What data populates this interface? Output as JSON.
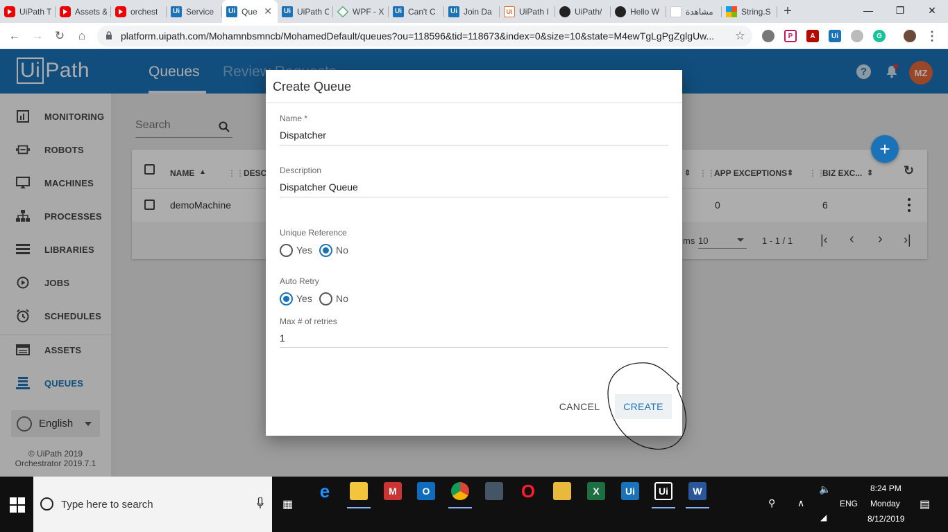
{
  "browser": {
    "tabs": [
      {
        "icon": "youtube-icon",
        "label": "UiPath T"
      },
      {
        "icon": "youtube-icon",
        "label": "Assets &"
      },
      {
        "icon": "youtube-icon",
        "label": "orchest"
      },
      {
        "icon": "uipath-icon",
        "label": "Service"
      },
      {
        "icon": "uipath-icon",
        "label": "Que",
        "active": true
      },
      {
        "icon": "uipath-icon",
        "label": "UiPath C"
      },
      {
        "icon": "wpf-icon",
        "label": "WPF - X"
      },
      {
        "icon": "uipath-icon",
        "label": "Can't C"
      },
      {
        "icon": "uipath-icon",
        "label": "Join Da"
      },
      {
        "icon": "uipath-orange-icon",
        "label": "UiPath I"
      },
      {
        "icon": "github-icon",
        "label": "UiPath/"
      },
      {
        "icon": "github-icon",
        "label": "Hello W"
      },
      {
        "icon": "arabic-site-icon",
        "label": "مشاهدة"
      },
      {
        "icon": "microsoft-icon",
        "label": "String.S"
      }
    ],
    "close_tab_glyph": "✕",
    "new_tab_glyph": "+",
    "url": "platform.uipath.com/Mohamnbsmncb/MohamedDefault/queues?ou=118596&tid=118673&index=0&size=10&state=M4ewTgLgPgZglgUw..."
  },
  "app": {
    "logo_box": "Ui",
    "logo_rest": "Path",
    "header_tabs": [
      "Queues",
      "Review Requests"
    ],
    "help_glyph": "?",
    "avatar_initials": "MZ",
    "accent_color": "#1a73b8"
  },
  "sidebar": {
    "items": [
      {
        "label": "MONITORING",
        "icon": "chart-icon"
      },
      {
        "label": "ROBOTS",
        "icon": "robot-icon"
      },
      {
        "label": "MACHINES",
        "icon": "monitor-icon"
      },
      {
        "label": "PROCESSES",
        "icon": "hierarchy-icon"
      },
      {
        "label": "LIBRARIES",
        "icon": "list-icon"
      },
      {
        "label": "JOBS",
        "icon": "play-icon"
      },
      {
        "label": "SCHEDULES",
        "icon": "clock-icon"
      },
      {
        "label": "ASSETS",
        "icon": "table-icon"
      },
      {
        "label": "QUEUES",
        "icon": "queue-icon",
        "active": true
      }
    ],
    "language": "English",
    "copyright": [
      "© UiPath 2019",
      "Orchestrator 2019.7.1"
    ]
  },
  "main": {
    "search_placeholder": "Search",
    "table": {
      "headers": [
        "NAME",
        "DESC",
        "APP EXCEPTIONS",
        "BIZ EXC..."
      ],
      "rows": [
        {
          "name": "demoMachine",
          "app_exceptions": "0",
          "biz_exceptions": "6"
        }
      ]
    },
    "pager": {
      "items_label": "ms",
      "page_size": "10",
      "range": "1 - 1 / 1"
    }
  },
  "dialog": {
    "title": "Create Queue",
    "name_label": "Name *",
    "name_value": "Dispatcher",
    "description_label": "Description",
    "description_value": "Dispatcher Queue",
    "unique_reference": {
      "label": "Unique Reference",
      "options": [
        "Yes",
        "No"
      ],
      "selected": "No"
    },
    "auto_retry": {
      "label": "Auto Retry",
      "options": [
        "Yes",
        "No"
      ],
      "selected": "Yes"
    },
    "max_retries_label": "Max # of retries",
    "max_retries_value": "1",
    "cancel_label": "CANCEL",
    "create_label": "CREATE"
  },
  "taskbar": {
    "search_placeholder": "Type here to search",
    "apps": [
      "edge-icon",
      "file-explorer-icon",
      "mail-icon",
      "outlook-icon",
      "chrome-icon",
      "app-icon",
      "opera-icon",
      "sticky-icon",
      "excel-icon",
      "uipath-studio-icon",
      "uipath-robot-icon",
      "word-icon"
    ],
    "language": "ENG",
    "time": "8:24 PM",
    "day": "Monday",
    "date": "8/12/2019"
  }
}
